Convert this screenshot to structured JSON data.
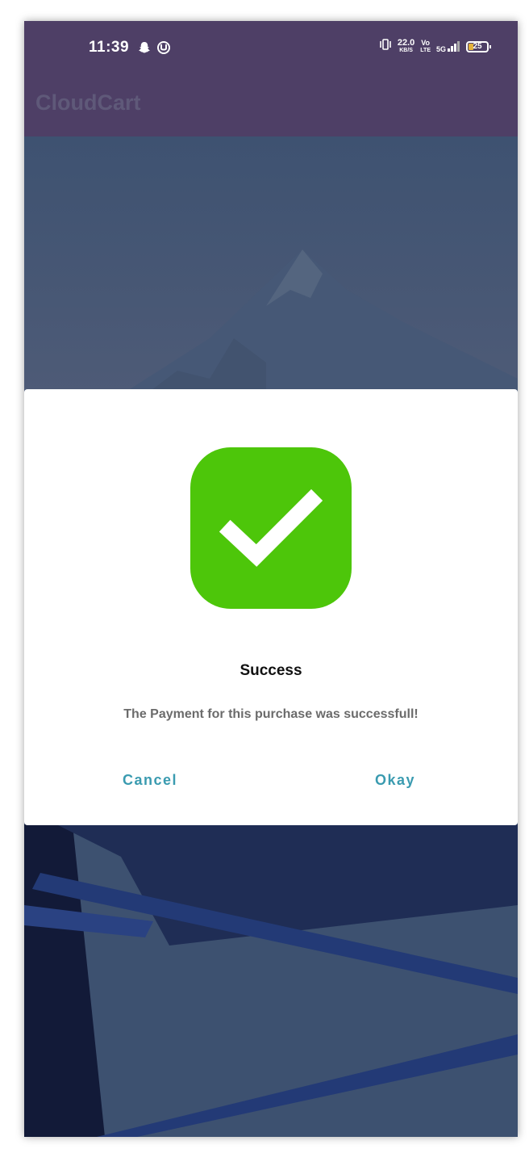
{
  "status_bar": {
    "time": "11:39",
    "net_speed": "22.0",
    "net_unit": "KB/S",
    "volte_top": "Vo",
    "volte_bottom": "LTE",
    "network": "5G",
    "battery": "25",
    "icons": [
      "snapchat-icon",
      "notification-icon",
      "vibrate-icon",
      "signal-icon",
      "battery-icon"
    ]
  },
  "app": {
    "title": "CloudCart"
  },
  "dialog": {
    "icon": "check-icon",
    "title": "Success",
    "message": "The Payment for this purchase was successfull!",
    "cancel_label": "Cancel",
    "okay_label": "Okay"
  },
  "colors": {
    "status_bar": "#4e3f66",
    "success_green": "#4dc60a",
    "button_text": "#3a9bb0",
    "scrim_background": "#3e5271"
  }
}
